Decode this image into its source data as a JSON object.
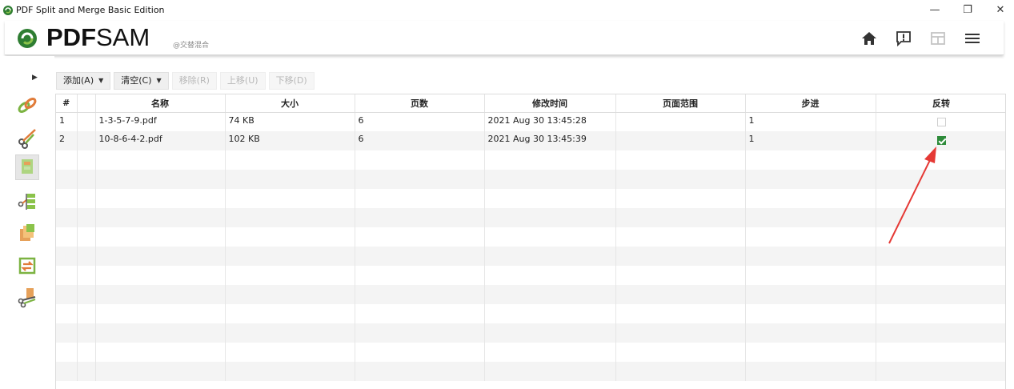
{
  "window": {
    "title": "PDF Split and Merge Basic Edition",
    "controls": [
      "—",
      "❐",
      "✕"
    ]
  },
  "header": {
    "logo_bold": "PDF",
    "logo_light": "SAM",
    "logo_sub": "@交替混合",
    "buttons": [
      "home-icon",
      "feedback-icon",
      "dashboard-icon",
      "menu-icon"
    ]
  },
  "toolbar": {
    "add_label": "添加(A)",
    "clear_label": "清空(C)",
    "remove_label": "移除(R)",
    "move_up_label": "上移(U)",
    "move_down_label": "下移(D)"
  },
  "table": {
    "columns": [
      "#",
      "",
      "名称",
      "大小",
      "页数",
      "修改时间",
      "页面范围",
      "步进",
      "反转"
    ],
    "rows": [
      {
        "num": "1",
        "name": "1-3-5-7-9.pdf",
        "size": "74 KB",
        "pages": "6",
        "modified": "2021 Aug 30 13:45:28",
        "range": "",
        "step": "1",
        "reverse": false
      },
      {
        "num": "2",
        "name": "10-8-6-4-2.pdf",
        "size": "102 KB",
        "pages": "6",
        "modified": "2021 Aug 30 13:45:39",
        "range": "",
        "step": "1",
        "reverse": true
      }
    ]
  },
  "colors": {
    "accent_green": "#2e8b3a",
    "annotation_red": "#e53935"
  }
}
